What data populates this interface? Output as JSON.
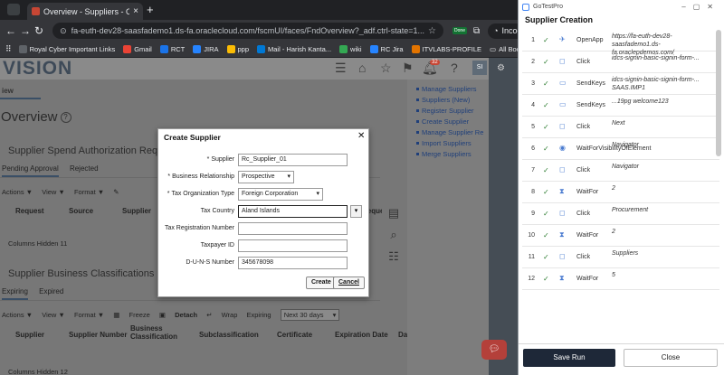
{
  "browser": {
    "tab_title": "Overview - Suppliers - Oracle F",
    "new_tab": "+",
    "url": "fa-euth-dev28-saasfademo1.ds-fa.oraclecloud.com/fscmUI/faces/FndOverview?_adf.ctrl-state=1...",
    "incognito_label": "Incognito",
    "ext_badge": "Done",
    "bookmarks": [
      {
        "label": "Royal Cyber Important Links",
        "color": "#5f6368"
      },
      {
        "label": "Gmail",
        "color": "#ea4335"
      },
      {
        "label": "RCT",
        "color": "#1a73e8"
      },
      {
        "label": "JIRA",
        "color": "#2684ff"
      },
      {
        "label": "ppp",
        "color": "#fbbc04"
      },
      {
        "label": "Mail - Harish Kanta...",
        "color": "#0078d4"
      },
      {
        "label": "wiki",
        "color": "#34a853"
      },
      {
        "label": "RC Jira",
        "color": "#2684ff"
      },
      {
        "label": "ITVLABS-PROFILE",
        "color": "#e37400"
      }
    ],
    "all_bookmarks": "All Bookmarks"
  },
  "oracle": {
    "logo": "VISION",
    "notif_count": "32",
    "avatar": "SI",
    "crumb": "iew",
    "overview_title": "Overview",
    "section1_title": "Supplier Spend Authorization Requests",
    "section1_tabs": [
      "Pending Approval",
      "Rejected"
    ],
    "section1_toolbar": [
      "Actions ▼",
      "View ▼",
      "Format ▼"
    ],
    "section1_columns": [
      "Request",
      "Source",
      "Supplier",
      "Request Date"
    ],
    "section1_hidden": "Columns Hidden  11",
    "section2_title": "Supplier Business Classifications",
    "section2_tabs": [
      "Expiring",
      "Expired"
    ],
    "section2_toolbar": [
      "Actions ▼",
      "View ▼",
      "Format ▼",
      "Freeze",
      "Detach",
      "Wrap"
    ],
    "expiring_label": "Expiring",
    "expiring_value": "Next 30 days",
    "section2_columns": [
      "Supplier",
      "Supplier Number",
      "Business Classification",
      "Subclassification",
      "Certificate",
      "Expiration Date",
      "Days"
    ],
    "section2_hidden": "Columns Hidden  12",
    "tasks": [
      "Manage Suppliers",
      "Suppliers (New)",
      "Register Supplier",
      "Create Supplier",
      "Manage Supplier Re",
      "Import Suppliers",
      "Merge Suppliers"
    ]
  },
  "dialog": {
    "title": "Create Supplier",
    "close": "✕",
    "fields": {
      "supplier": {
        "label": "Supplier",
        "required": "*",
        "value": "Rc_Supplier_01"
      },
      "business_relationship": {
        "label": "Business Relationship",
        "required": "*",
        "value": "Prospective"
      },
      "tax_org_type": {
        "label": "Tax Organization Type",
        "required": "*",
        "value": "Foreign Corporation"
      },
      "tax_country": {
        "label": "Tax Country",
        "value": "Aland Islands"
      },
      "tax_reg_number": {
        "label": "Tax Registration Number",
        "value": ""
      },
      "taxpayer_id": {
        "label": "Taxpayer ID",
        "value": ""
      },
      "duns": {
        "label": "D-U-N-S Number",
        "value": "345678098"
      }
    },
    "create_label": "Create",
    "cancel_label": "Cancel"
  },
  "gotestpro": {
    "window_title": "GoTestPro",
    "heading": "Supplier Creation",
    "steps": [
      {
        "num": "1",
        "action": "OpenApp",
        "value": "https://fa-euth-dev28-saasfademo1.ds-fa.oraclepdemos.com/"
      },
      {
        "num": "2",
        "action": "Click",
        "value": "idcs-signin-basic-signin-form-..."
      },
      {
        "num": "3",
        "action": "SendKeys",
        "value": "idcs-signin-basic-signin-form-... SAAS.IMP1"
      },
      {
        "num": "4",
        "action": "SendKeys",
        "value": "...19pg    welcome123"
      },
      {
        "num": "5",
        "action": "Click",
        "value": "Next"
      },
      {
        "num": "6",
        "action": "WaitForVisibilityOfElement",
        "value": "Navigator"
      },
      {
        "num": "7",
        "action": "Click",
        "value": "Navigator"
      },
      {
        "num": "8",
        "action": "WaitFor",
        "value": "2"
      },
      {
        "num": "9",
        "action": "Click",
        "value": "Procurement"
      },
      {
        "num": "10",
        "action": "WaitFor",
        "value": "2"
      },
      {
        "num": "11",
        "action": "Click",
        "value": "Suppliers"
      },
      {
        "num": "12",
        "action": "WaitFor",
        "value": "5"
      }
    ],
    "save_run": "Save Run",
    "close": "Close"
  }
}
